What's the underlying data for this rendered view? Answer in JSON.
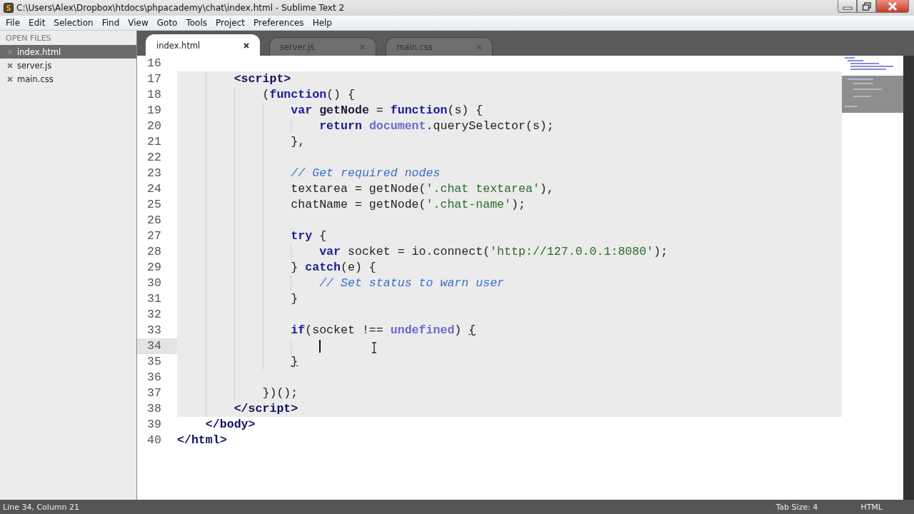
{
  "window": {
    "title": "C:\\Users\\Alex\\Dropbox\\htdocs\\phpacademy\\chat\\index.html - Sublime Text 2"
  },
  "menu": [
    "File",
    "Edit",
    "Selection",
    "Find",
    "View",
    "Goto",
    "Tools",
    "Project",
    "Preferences",
    "Help"
  ],
  "sidebar": {
    "header": "OPEN FILES",
    "items": [
      {
        "label": "index.html",
        "selected": true
      },
      {
        "label": "server.js",
        "selected": false
      },
      {
        "label": "main.css",
        "selected": false
      }
    ]
  },
  "tabs": [
    {
      "label": "index.html",
      "selected": true
    },
    {
      "label": "server.js",
      "selected": false
    },
    {
      "label": "main.css",
      "selected": false
    }
  ],
  "editor": {
    "lines": [
      {
        "children": [
          {
            "number": "16",
            "embedded": false,
            "current": false
          },
          {
            "children": [
              {
                "number": "17",
                "embedded": true,
                "current": false,
                "tokens": [
                  {
                    "kind": "tag",
                    "text": "<script>"
                  }
                ]
              },
              {
                "children": [
                  {
                    "number": "18",
                    "embedded": true,
                    "current": false,
                    "tokens": [
                      {
                        "kind": "plain",
                        "text": "("
                      },
                      {
                        "kind": "keyword",
                        "text": "function"
                      },
                      {
                        "kind": "plain",
                        "text": "() {"
                      }
                    ]
                  },
                  {
                    "children": [
                      {
                        "number": "19",
                        "embedded": true,
                        "current": false,
                        "tokens": [
                          {
                            "kind": "keyword",
                            "text": "var "
                          },
                          {
                            "kind": "name",
                            "text": "getNode"
                          },
                          {
                            "kind": "plain",
                            "text": " = "
                          },
                          {
                            "kind": "keyword",
                            "text": "function"
                          },
                          {
                            "kind": "plain",
                            "text": "(s) {"
                          }
                        ]
                      },
                      {
                        "children": [
                          {
                            "number": "20",
                            "embedded": true,
                            "current": false,
                            "tokens": [
                              {
                                "kind": "keyword",
                                "text": "return "
                              },
                              {
                                "kind": "builtin",
                                "text": "document"
                              },
                              {
                                "kind": "plain",
                                "text": ".querySelector(s);"
                              }
                            ]
                          }
                        ]
                      },
                      {
                        "number": "21",
                        "embedded": true,
                        "current": false,
                        "tokens": [
                          {
                            "kind": "plain",
                            "text": "},"
                          }
                        ]
                      },
                      {
                        "number": "22",
                        "embedded": true,
                        "current": false
                      },
                      {
                        "number": "23",
                        "embedded": true,
                        "current": false,
                        "tokens": [
                          {
                            "kind": "comment",
                            "text": "// Get required nodes"
                          }
                        ]
                      },
                      {
                        "number": "24",
                        "embedded": true,
                        "current": false,
                        "tokens": [
                          {
                            "kind": "plain",
                            "text": "textarea = getNode("
                          },
                          {
                            "kind": "string",
                            "text": "'.chat textarea'"
                          },
                          {
                            "kind": "plain",
                            "text": "),"
                          }
                        ]
                      },
                      {
                        "number": "25",
                        "embedded": true,
                        "current": false,
                        "tokens": [
                          {
                            "kind": "plain",
                            "text": "chatName = getNode("
                          },
                          {
                            "kind": "string",
                            "text": "'.chat-name'"
                          },
                          {
                            "kind": "plain",
                            "text": ");"
                          }
                        ]
                      },
                      {
                        "number": "26",
                        "embedded": true,
                        "current": false
                      },
                      {
                        "number": "27",
                        "embedded": true,
                        "current": false,
                        "tokens": [
                          {
                            "kind": "keyword",
                            "text": "try"
                          },
                          {
                            "kind": "plain",
                            "text": " {"
                          }
                        ]
                      },
                      {
                        "children": [
                          {
                            "number": "28",
                            "embedded": true,
                            "current": false,
                            "tokens": [
                              {
                                "kind": "keyword",
                                "text": "var"
                              },
                              {
                                "kind": "plain",
                                "text": " socket = io.connect("
                              },
                              {
                                "kind": "string",
                                "text": "'http://127.0.0.1:8080'"
                              },
                              {
                                "kind": "plain",
                                "text": ");"
                              }
                            ]
                          }
                        ]
                      },
                      {
                        "number": "29",
                        "embedded": true,
                        "current": false,
                        "tokens": [
                          {
                            "kind": "plain",
                            "text": "} "
                          },
                          {
                            "kind": "keyword",
                            "text": "catch"
                          },
                          {
                            "kind": "plain",
                            "text": "(e) {"
                          }
                        ]
                      },
                      {
                        "children": [
                          {
                            "number": "30",
                            "embedded": true,
                            "current": false,
                            "tokens": [
                              {
                                "kind": "comment",
                                "text": "// Set status to warn user"
                              }
                            ]
                          }
                        ]
                      },
                      {
                        "number": "31",
                        "embedded": true,
                        "current": false,
                        "tokens": [
                          {
                            "kind": "plain",
                            "text": "}"
                          }
                        ]
                      },
                      {
                        "number": "32",
                        "embedded": true,
                        "current": false
                      },
                      {
                        "number": "33",
                        "embedded": true,
                        "current": false,
                        "tokens": [
                          {
                            "kind": "keyword",
                            "text": "if"
                          },
                          {
                            "kind": "plain",
                            "text": "(socket !== "
                          },
                          {
                            "kind": "builtin",
                            "text": "undefined"
                          },
                          {
                            "kind": "plain",
                            "text": ") "
                          },
                          {
                            "kind": "bracket",
                            "text": "{"
                          }
                        ]
                      },
                      {
                        "children": [
                          {
                            "number": "34",
                            "embedded": true,
                            "current": true,
                            "cursor": true
                          }
                        ]
                      },
                      {
                        "number": "35",
                        "embedded": true,
                        "current": false,
                        "tokens": [
                          {
                            "kind": "bracket",
                            "text": "}"
                          }
                        ]
                      }
                    ]
                  },
                  {
                    "number": "36",
                    "embedded": true,
                    "current": false
                  },
                  {
                    "number": "37",
                    "embedded": true,
                    "current": false,
                    "tokens": [
                      {
                        "kind": "plain",
                        "text": "})();"
                      }
                    ]
                  }
                ]
              },
              {
                "number": "38",
                "embedded": true,
                "current": false,
                "tokens": [
                  {
                    "kind": "tag",
                    "text": "</script>"
                  }
                ]
              }
            ]
          },
          {
            "number": "39",
            "embedded": false,
            "current": false,
            "tokens": [
              {
                "kind": "tag",
                "text": "</body>"
              }
            ]
          }
        ]
      },
      {
        "number": "40",
        "embedded": false,
        "current": false,
        "tokens": [
          {
            "kind": "tag",
            "text": "</html>"
          }
        ]
      }
    ]
  },
  "status_bar": {
    "position": "Line 34, Column 21",
    "tab_size": "Tab Size: 4",
    "syntax": "HTML"
  }
}
